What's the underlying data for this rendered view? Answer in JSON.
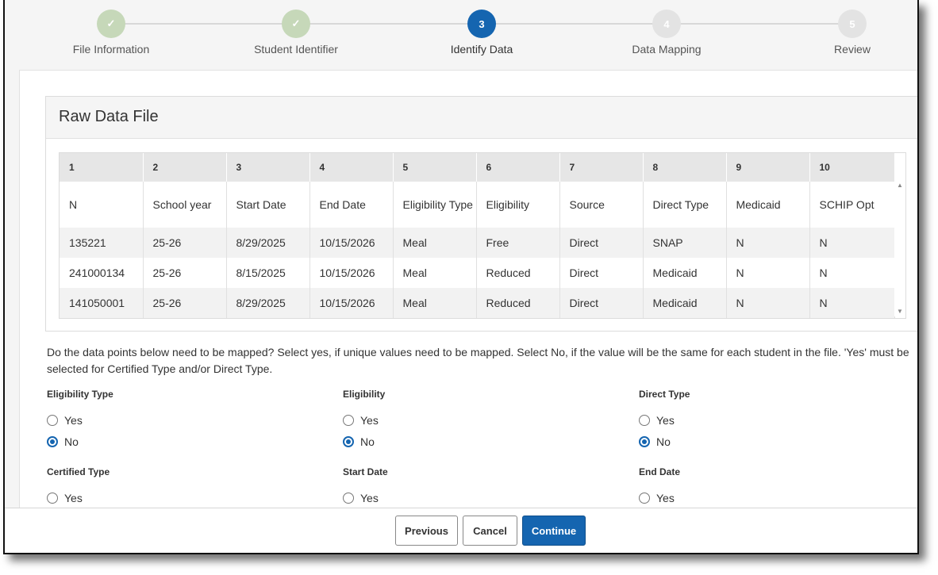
{
  "stepper": {
    "steps": [
      {
        "label": "File Information",
        "number": "✓",
        "state": "done"
      },
      {
        "label": "Student Identifier",
        "number": "✓",
        "state": "done"
      },
      {
        "label": "Identify Data",
        "number": "3",
        "state": "active"
      },
      {
        "label": "Data Mapping",
        "number": "4",
        "state": "todo"
      },
      {
        "label": "Review",
        "number": "5",
        "state": "todo"
      }
    ]
  },
  "raw_panel": {
    "title": "Raw Data File",
    "column_numbers": [
      "1",
      "2",
      "3",
      "4",
      "5",
      "6",
      "7",
      "8",
      "9",
      "10"
    ],
    "rows": [
      [
        "N",
        "School year",
        "Start Date",
        "End Date",
        "Eligibility Type",
        "Eligibility",
        "Source",
        "Direct Type",
        "Medicaid",
        "SCHIP Opt"
      ],
      [
        "135221",
        "25-26",
        "8/29/2025",
        "10/15/2026",
        "Meal",
        "Free",
        "Direct",
        "SNAP",
        "N",
        "N"
      ],
      [
        "241000134",
        "25-26",
        "8/15/2025",
        "10/15/2026",
        "Meal",
        "Reduced",
        "Direct",
        "Medicaid",
        "N",
        "N"
      ],
      [
        "141050001",
        "25-26",
        "8/29/2025",
        "10/15/2026",
        "Meal",
        "Reduced",
        "Direct",
        "Medicaid",
        "N",
        "N"
      ]
    ]
  },
  "mapping": {
    "question": "Do the data points below need to be mapped? Select yes, if unique values need to be mapped. Select No, if the value will be the same for each student in the file. 'Yes' must be selected for Certified Type and/or Direct Type.",
    "yes_label": "Yes",
    "no_label": "No",
    "fields": [
      {
        "title": "Eligibility Type",
        "selected": "No"
      },
      {
        "title": "Eligibility",
        "selected": "No"
      },
      {
        "title": "Direct Type",
        "selected": "No"
      },
      {
        "title": "Certified Type",
        "selected": ""
      },
      {
        "title": "Start Date",
        "selected": ""
      },
      {
        "title": "End Date",
        "selected": ""
      }
    ]
  },
  "footer": {
    "previous_label": "Previous",
    "cancel_label": "Cancel",
    "continue_label": "Continue"
  },
  "colors": {
    "accent": "#1565b0",
    "step_done": "#c6d8b9",
    "step_todo": "#e3e3e3"
  }
}
